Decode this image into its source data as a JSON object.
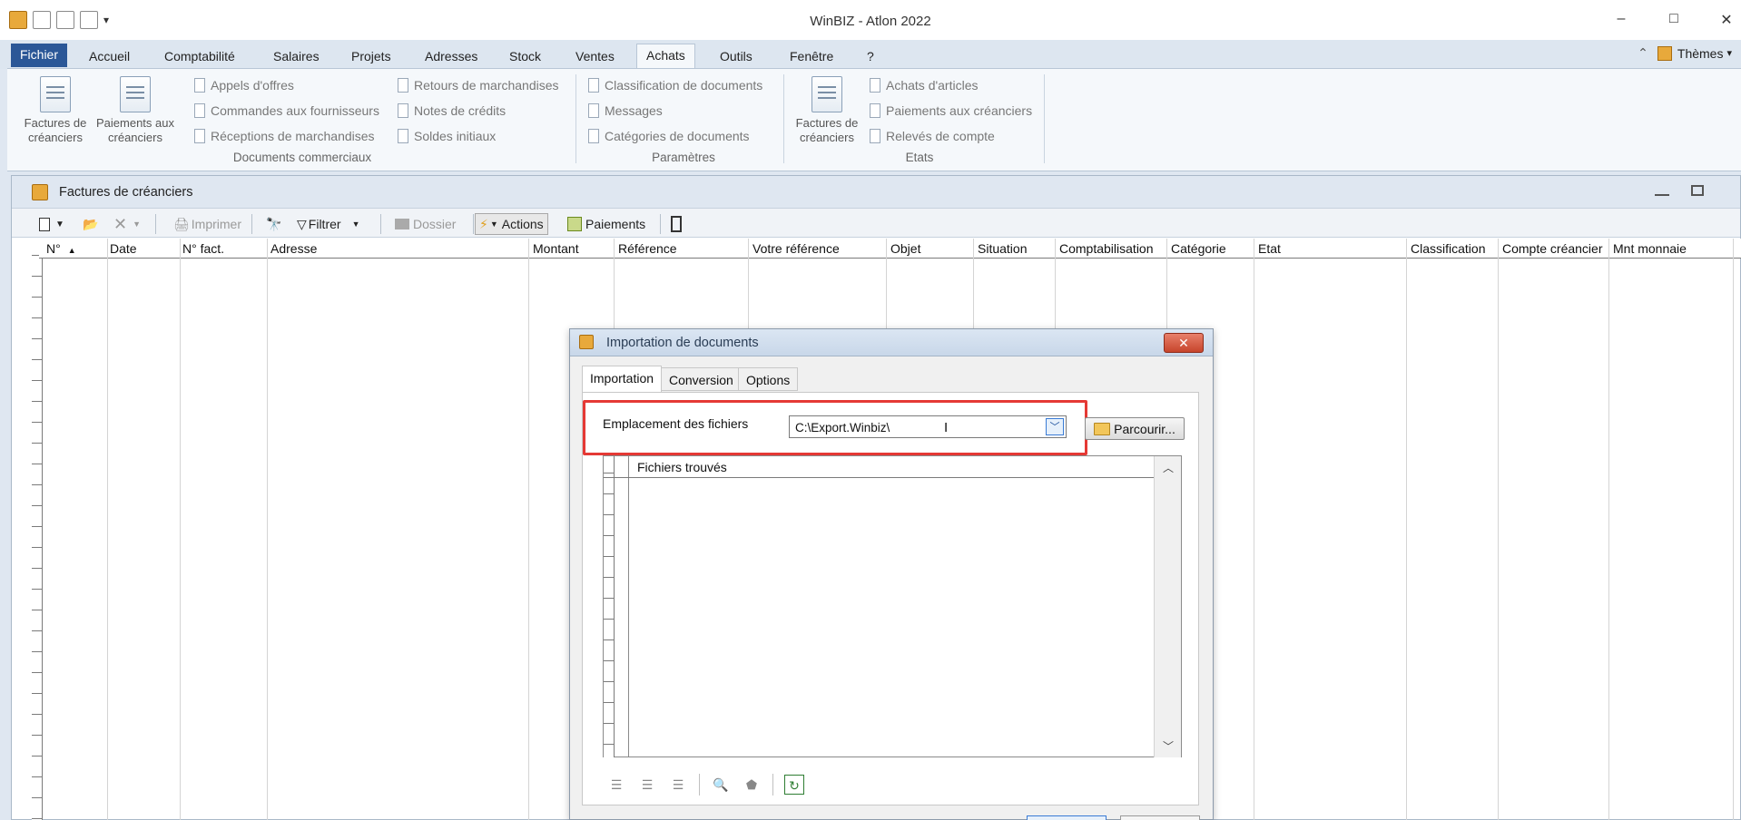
{
  "window": {
    "title": "WinBIZ - Atlon 2022",
    "minimize": "–",
    "maximize": "□",
    "close": "✕"
  },
  "ribbon_tabs": [
    {
      "label": "Fichier"
    },
    {
      "label": "Accueil"
    },
    {
      "label": "Comptabilité"
    },
    {
      "label": "Salaires"
    },
    {
      "label": "Projets"
    },
    {
      "label": "Adresses"
    },
    {
      "label": "Stock"
    },
    {
      "label": "Ventes"
    },
    {
      "label": "Achats"
    },
    {
      "label": "Outils"
    },
    {
      "label": "Fenêtre"
    },
    {
      "label": "?"
    }
  ],
  "ribbon_right": {
    "themes": "Thèmes"
  },
  "ribbon": {
    "large1": "Factures de créanciers",
    "large2": "Paiements aux créanciers",
    "commercial": [
      "Appels d'offres",
      "Commandes aux fournisseurs",
      "Réceptions de marchandises"
    ],
    "commercial2": [
      "Retours de marchandises",
      "Notes de crédits",
      "Soldes initiaux"
    ],
    "group1_label": "Documents commerciaux",
    "params": [
      "Classification de documents",
      "Messages",
      "Catégories de documents"
    ],
    "group2_label": "Paramètres",
    "large3": "Factures de créanciers",
    "etats": [
      "Achats d'articles",
      "Paiements aux créanciers",
      "Relevés de compte"
    ],
    "group3_label": "Etats"
  },
  "child_window": {
    "title": "Factures de créanciers",
    "toolbar": {
      "print": "Imprimer",
      "filter": "Filtrer",
      "folder": "Dossier",
      "actions": "Actions",
      "payments": "Paiements"
    },
    "columns": [
      "N°",
      "Date",
      "N° fact.",
      "Adresse",
      "Montant",
      "Référence",
      "Votre référence",
      "Objet",
      "Situation",
      "Comptabilisation",
      "Catégorie",
      "Etat",
      "Classification",
      "Compte créancier",
      "Mnt monnaie"
    ]
  },
  "dialog": {
    "title": "Importation de documents",
    "close": "✕",
    "tabs": [
      "Importation",
      "Conversion",
      "Options"
    ],
    "location_label": "Emplacement des fichiers",
    "location_value": "C:\\Export.Winbiz\\",
    "browse": "Parcourir...",
    "files_header": "Fichiers trouvés"
  },
  "colors": {
    "accent": "#2b5797",
    "highlight": "#e53935"
  }
}
